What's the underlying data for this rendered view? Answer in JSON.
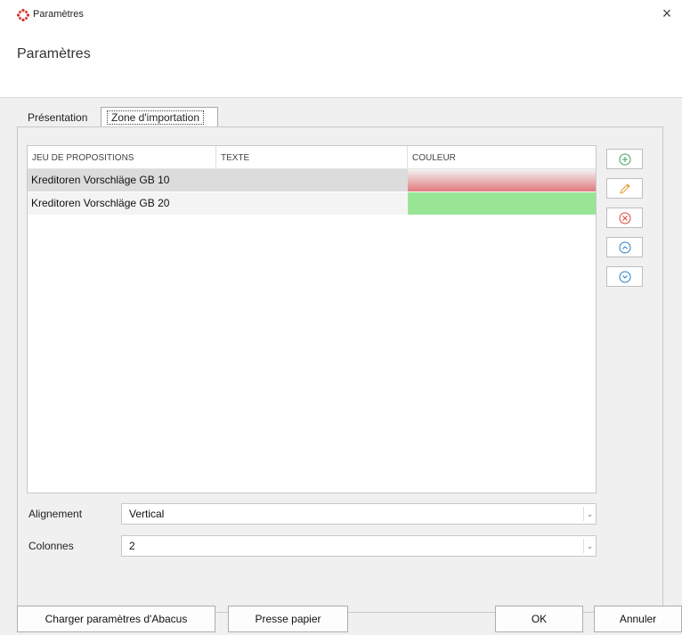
{
  "window": {
    "title": "Paramètres",
    "close_symbol": "×"
  },
  "header": {
    "title": "Paramètres"
  },
  "tabs": [
    {
      "label": "Présentation",
      "active": false
    },
    {
      "label": "Zone d'importation",
      "active": true
    }
  ],
  "table": {
    "columns": [
      "JEU DE PROPOSITIONS",
      "TEXTE",
      "COULEUR"
    ],
    "rows": [
      {
        "jeu": "Kreditoren Vorschläge GB 10",
        "texte": "",
        "couleur": "#e07a7c"
      },
      {
        "jeu": "Kreditoren Vorschläge GB 20",
        "texte": "",
        "couleur": "#99e596"
      }
    ]
  },
  "side_buttons": [
    {
      "name": "add-icon",
      "color": "#3fa35a"
    },
    {
      "name": "edit-icon",
      "color": "#e39a2b"
    },
    {
      "name": "remove-icon",
      "color": "#d9463e"
    },
    {
      "name": "move-up-icon",
      "color": "#2b7fc4"
    },
    {
      "name": "move-down-icon",
      "color": "#2b7fc4"
    }
  ],
  "fields": {
    "alignement": {
      "label": "Alignement",
      "value": "Vertical"
    },
    "colonnes": {
      "label": "Colonnes",
      "value": "2"
    }
  },
  "buttons": {
    "charger": "Charger paramètres d'Abacus",
    "presse": "Presse papier",
    "ok": "OK",
    "annuler": "Annuler"
  }
}
